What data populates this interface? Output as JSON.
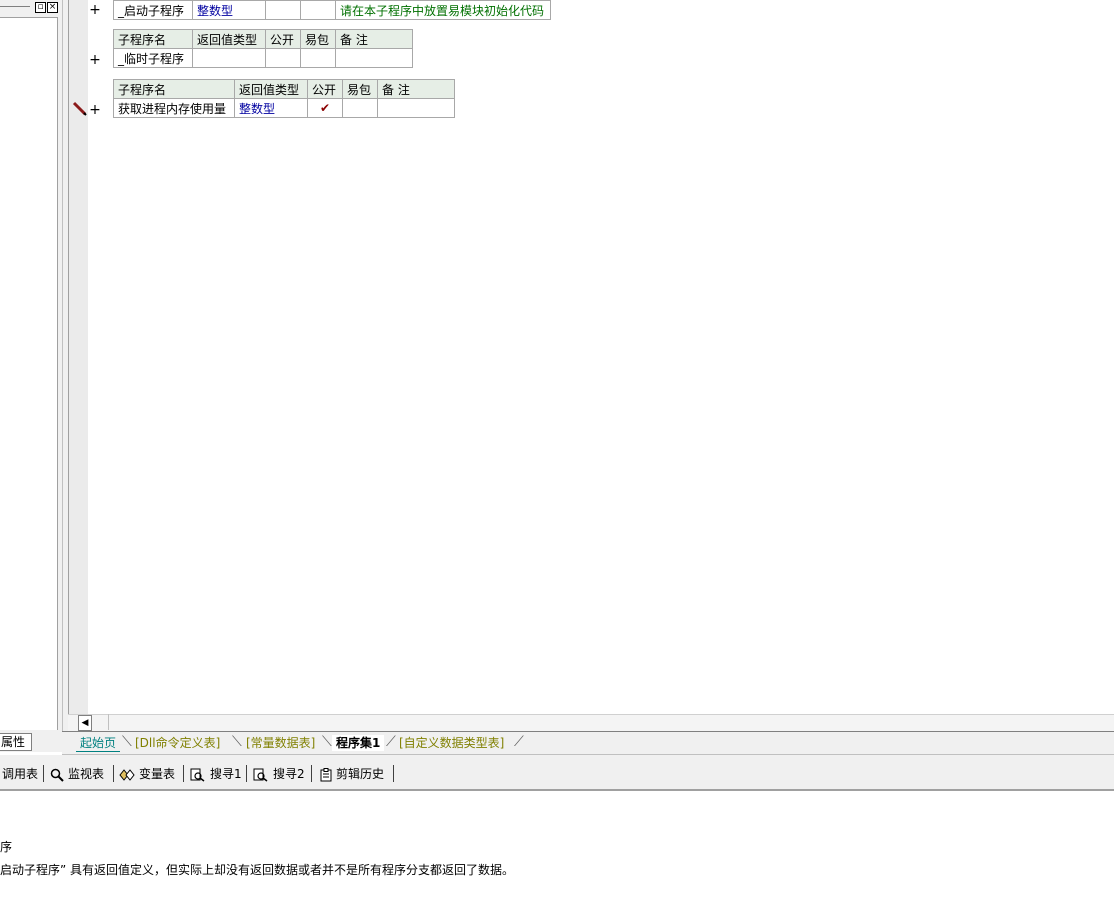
{
  "left_panel": {
    "property_tab_label": "属性"
  },
  "tables": [
    {
      "header": null,
      "row": {
        "name": "_启动子程序",
        "return_type": "整数型",
        "public": "",
        "easy_pack": "",
        "note": "请在本子程序中放置易模块初始化代码"
      }
    },
    {
      "header": {
        "name": "子程序名",
        "return_type": "返回值类型",
        "public": "公开",
        "easy_pack": "易包",
        "note": "备 注"
      },
      "row": {
        "name": "_临时子程序",
        "return_type": "",
        "public": "",
        "easy_pack": "",
        "note": ""
      }
    },
    {
      "header": {
        "name": "子程序名",
        "return_type": "返回值类型",
        "public": "公开",
        "easy_pack": "易包",
        "note": "备 注"
      },
      "row": {
        "name": "获取进程内存使用量",
        "return_type": "整数型",
        "public": "✔",
        "easy_pack": "",
        "note": ""
      }
    }
  ],
  "gutter": {
    "plus": "+"
  },
  "tabs": [
    {
      "label": "起始页",
      "color": "#008080"
    },
    {
      "label": "[Dll命令定义表]",
      "color": "#808000"
    },
    {
      "label": "[常量数据表]",
      "color": "#808000"
    },
    {
      "label": "程序集1",
      "color": "#000000",
      "active": true
    },
    {
      "label": "[自定义数据类型表]",
      "color": "#808000"
    }
  ],
  "toolbar": [
    {
      "label": "调用表",
      "icon": "call-table-icon"
    },
    {
      "label": "监视表",
      "icon": "magnifier-icon"
    },
    {
      "label": "变量表",
      "icon": "variable-icon"
    },
    {
      "label": "搜寻1",
      "icon": "search-doc-icon"
    },
    {
      "label": "搜寻2",
      "icon": "search-doc-icon"
    },
    {
      "label": "剪辑历史",
      "icon": "clipboard-icon"
    }
  ],
  "output": {
    "line1": "序",
    "line2": "启动子程序” 具有返回值定义，但实际上却没有返回数据或者并不是所有程序分支都返回了数据。"
  },
  "colors": {
    "header_bg": "#e6eee6",
    "type_text": "#0000a0",
    "note_text": "#007000"
  }
}
